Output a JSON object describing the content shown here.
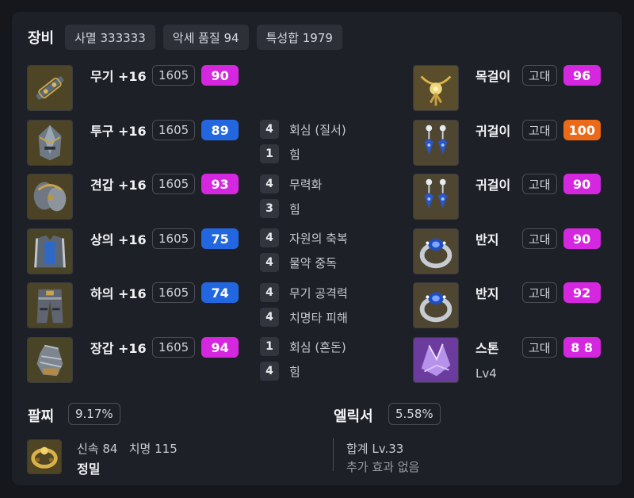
{
  "header": {
    "title": "장비",
    "chips": [
      "사멸 333333",
      "악세 품질 94",
      "특성합 1979"
    ]
  },
  "equipment": [
    {
      "name": "무기 +16",
      "level": "1605",
      "quality": "90",
      "quality_color": "#d627e0",
      "icon": "weapon-icon"
    },
    {
      "name": "투구 +16",
      "level": "1605",
      "quality": "89",
      "quality_color": "#2367e0",
      "icon": "helmet-icon"
    },
    {
      "name": "견갑 +16",
      "level": "1605",
      "quality": "93",
      "quality_color": "#d627e0",
      "icon": "shoulder-icon"
    },
    {
      "name": "상의 +16",
      "level": "1605",
      "quality": "75",
      "quality_color": "#2367e0",
      "icon": "chest-icon"
    },
    {
      "name": "하의 +16",
      "level": "1605",
      "quality": "74",
      "quality_color": "#2367e0",
      "icon": "pants-icon"
    },
    {
      "name": "장갑 +16",
      "level": "1605",
      "quality": "94",
      "quality_color": "#d627e0",
      "icon": "gloves-icon"
    }
  ],
  "engravings": [
    {
      "level": "4",
      "name": "회심 (질서)"
    },
    {
      "level": "1",
      "name": "힘"
    },
    {
      "level": "4",
      "name": "무력화"
    },
    {
      "level": "3",
      "name": "힘"
    },
    {
      "level": "4",
      "name": "자원의 축복"
    },
    {
      "level": "4",
      "name": "물약 중독"
    },
    {
      "level": "4",
      "name": "무기 공격력"
    },
    {
      "level": "4",
      "name": "치명타 피해"
    },
    {
      "level": "1",
      "name": "회심 (혼돈)"
    },
    {
      "level": "4",
      "name": "힘"
    }
  ],
  "accessories": [
    {
      "name": "목걸이",
      "grade": "고대",
      "quality": "96",
      "quality_color": "#d627e0",
      "icon": "necklace-icon"
    },
    {
      "name": "귀걸이",
      "grade": "고대",
      "quality": "100",
      "quality_color": "#ec6a17",
      "icon": "earring-icon"
    },
    {
      "name": "귀걸이",
      "grade": "고대",
      "quality": "90",
      "quality_color": "#d627e0",
      "icon": "earring-icon"
    },
    {
      "name": "반지",
      "grade": "고대",
      "quality": "90",
      "quality_color": "#d627e0",
      "icon": "ring-icon"
    },
    {
      "name": "반지",
      "grade": "고대",
      "quality": "92",
      "quality_color": "#d627e0",
      "icon": "ring-icon"
    },
    {
      "name": "스톤",
      "grade": "고대",
      "quality": "8 8",
      "quality_color": "#d627e0",
      "sub": "Lv4",
      "icon": "stone-icon"
    }
  ],
  "bracelet": {
    "title": "팔찌",
    "percent": "9.17%",
    "stats": "신속 84   치명 115",
    "effect": "정밀"
  },
  "elixir": {
    "title": "엘릭서",
    "percent": "5.58%",
    "total": "합계 Lv.33",
    "effect": "추가 효과 없음"
  }
}
